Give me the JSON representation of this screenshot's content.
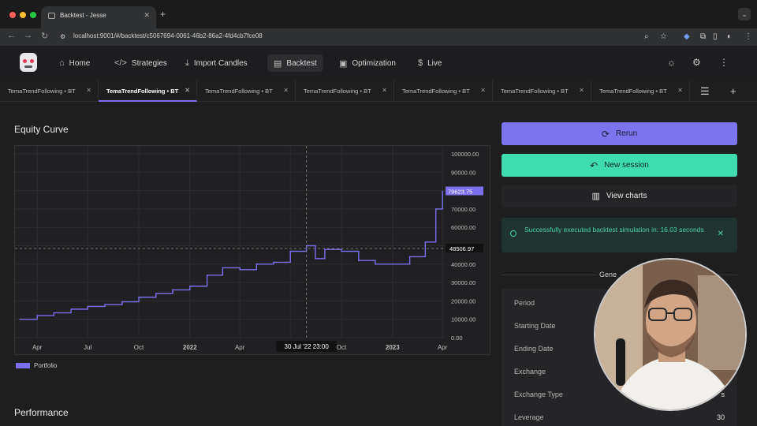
{
  "browser": {
    "tab_title": "Backtest - Jesse",
    "new_tab": "+",
    "url": "localhost:9001/#/backtest/c5067694-0061-46b2-86a2-4fd4cb7fce08"
  },
  "nav": {
    "items": [
      {
        "label": "Home",
        "icon": "home-icon"
      },
      {
        "label": "Strategies",
        "icon": "code-icon"
      },
      {
        "label": "Import Candles",
        "icon": "download-icon"
      },
      {
        "label": "Backtest",
        "icon": "document-icon"
      },
      {
        "label": "Optimization",
        "icon": "play-icon"
      },
      {
        "label": "Live",
        "icon": "dollar-icon"
      }
    ],
    "active": "Backtest"
  },
  "backtest_tabs": [
    {
      "label": "TemaTrendFollowing • BT"
    },
    {
      "label": "TemaTrendFollowing • BT",
      "active": true
    },
    {
      "label": "TemaTrendFollowing • BT"
    },
    {
      "label": "TemaTrendFollowing • BT"
    },
    {
      "label": "TemaTrendFollowing • BT"
    },
    {
      "label": "TemaTrendFollowing • BT"
    },
    {
      "label": "TemaTrendFollowing • BT"
    }
  ],
  "equity": {
    "title": "Equity Curve",
    "legend": "Portfolio",
    "crosshair_value": "48506.97",
    "last_value": "79623.75",
    "crosshair_time": "30 Jul '22   23:00"
  },
  "performance_title": "Performance",
  "actions": {
    "rerun": "Rerun",
    "new_session": "New session",
    "view_charts": "View charts"
  },
  "toast": {
    "message": "Successfully executed backtest simulation in: 16.03 seconds"
  },
  "general": {
    "title": "Gene",
    "rows": [
      {
        "label": "Period",
        "value": ""
      },
      {
        "label": "Starting Date",
        "value": ""
      },
      {
        "label": "Ending Date",
        "value": ""
      },
      {
        "label": "Exchange",
        "value": ""
      },
      {
        "label": "Exchange Type",
        "value": "s"
      },
      {
        "label": "Leverage",
        "value": "30"
      }
    ]
  },
  "colors": {
    "accent": "#7b74ee",
    "success": "#3fdcb0",
    "line": "#7b6ff0"
  },
  "chart_data": {
    "type": "line",
    "series": [
      {
        "name": "Portfolio",
        "x": [
          "2021-03-01",
          "2021-04-01",
          "2021-05-01",
          "2021-06-01",
          "2021-07-01",
          "2021-08-01",
          "2021-09-01",
          "2021-10-01",
          "2021-11-01",
          "2021-12-01",
          "2022-01-01",
          "2022-02-01",
          "2022-03-01",
          "2022-04-01",
          "2022-05-01",
          "2022-06-01",
          "2022-07-01",
          "2022-07-30",
          "2022-08-15",
          "2022-09-01",
          "2022-10-01",
          "2022-11-01",
          "2022-12-01",
          "2023-01-01",
          "2023-02-01",
          "2023-03-01",
          "2023-03-20",
          "2023-04-01"
        ],
        "values": [
          10000,
          12000,
          13500,
          15500,
          17000,
          18000,
          19500,
          22000,
          24000,
          26000,
          28000,
          34000,
          38000,
          37000,
          40000,
          41000,
          47000,
          50000,
          43000,
          48000,
          47000,
          42000,
          40000,
          40000,
          44000,
          52000,
          70000,
          79623
        ]
      }
    ],
    "xlabel": "",
    "ylabel": "",
    "x_ticks": [
      "Apr",
      "Jul",
      "Oct",
      "2022",
      "Apr",
      "Jul",
      "Oct",
      "2023",
      "Apr"
    ],
    "y_ticks": [
      "100000.00",
      "90000.00",
      "80000.00",
      "70000.00",
      "60000.00",
      "50000.00",
      "40000.00",
      "30000.00",
      "20000.00",
      "10000.00",
      "0.00"
    ],
    "ylim": [
      0,
      100000
    ],
    "grid": true
  }
}
